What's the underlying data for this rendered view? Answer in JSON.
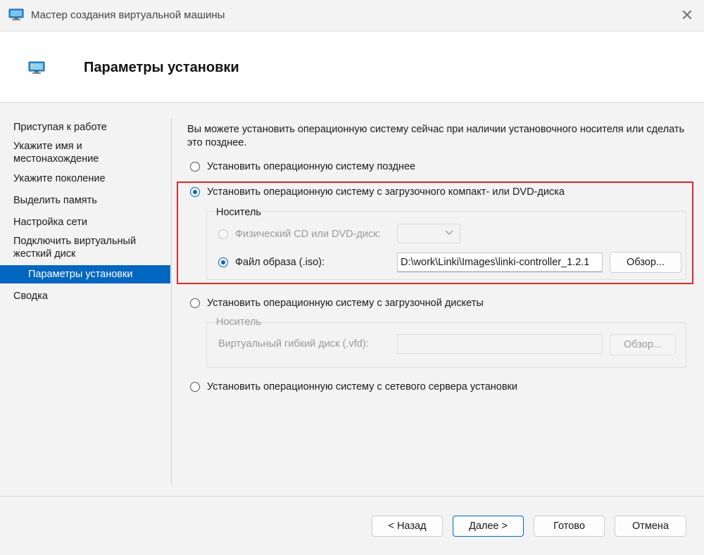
{
  "window": {
    "title": "Мастер создания виртуальной машины",
    "close_label": "✕"
  },
  "header": {
    "title": "Параметры установки"
  },
  "sidebar": {
    "items": [
      {
        "label": "Приступая к работе"
      },
      {
        "label": "Укажите имя и местонахождение"
      },
      {
        "label": "Укажите поколение"
      },
      {
        "label": "Выделить память"
      },
      {
        "label": "Настройка сети"
      },
      {
        "label": "Подключить виртуальный жесткий диск"
      },
      {
        "label": "Параметры установки",
        "active": true
      },
      {
        "label": "Сводка"
      }
    ]
  },
  "main": {
    "intro": "Вы можете установить операционную систему сейчас при наличии установочного носителя или сделать это позднее.",
    "options": [
      {
        "label": "Установить операционную систему позднее",
        "checked": false
      },
      {
        "label": "Установить операционную систему с загрузочного компакт- или DVD-диска",
        "checked": true
      },
      {
        "label": "Установить операционную систему с загрузочной дискеты",
        "checked": false
      },
      {
        "label": "Установить операционную систему с сетевого сервера установки",
        "checked": false
      }
    ],
    "dvd_group": {
      "legend": "Носитель",
      "physical_label": "Физический CD или DVD-диск:",
      "physical_checked": false,
      "iso_label": "Файл образа (.iso):",
      "iso_checked": true,
      "iso_path": "D:\\work\\Linki\\Images\\linki-controller_1.2.1",
      "browse_label": "Обзор..."
    },
    "floppy_group": {
      "legend": "Носитель",
      "vfd_label": "Виртуальный гибкий диск (.vfd):",
      "vfd_value": "",
      "browse_label": "Обзор..."
    }
  },
  "footer": {
    "back_label": "< Назад",
    "next_label": "Далее >",
    "finish_label": "Готово",
    "cancel_label": "Отмена"
  },
  "colors": {
    "accent": "#0067c0",
    "highlight": "#d62b2b"
  }
}
